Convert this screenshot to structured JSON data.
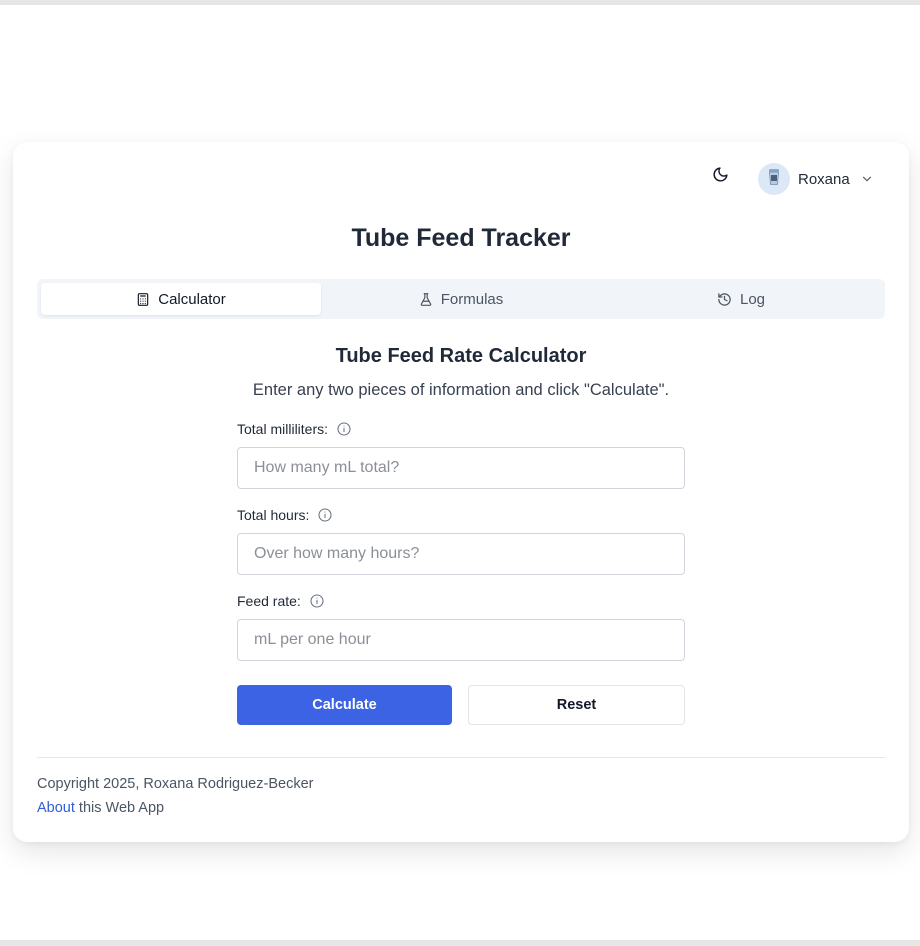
{
  "app": {
    "title": "Tube Feed Tracker"
  },
  "header": {
    "theme_icon": "moon-icon",
    "user": {
      "name": "Roxana",
      "avatar_icon": "cup-icon"
    }
  },
  "tabs": [
    {
      "label": "Calculator",
      "icon": "calculator-icon",
      "active": true
    },
    {
      "label": "Formulas",
      "icon": "flask-icon",
      "active": false
    },
    {
      "label": "Log",
      "icon": "history-icon",
      "active": false
    }
  ],
  "calculator": {
    "title": "Tube Feed Rate Calculator",
    "subtitle": "Enter any two pieces of information and click \"Calculate\".",
    "fields": [
      {
        "label": "Total milliliters:",
        "placeholder": "How many mL total?",
        "value": ""
      },
      {
        "label": "Total hours:",
        "placeholder": "Over how many hours?",
        "value": ""
      },
      {
        "label": "Feed rate:",
        "placeholder": "mL per one hour",
        "value": ""
      }
    ],
    "calculate_label": "Calculate",
    "reset_label": "Reset"
  },
  "footer": {
    "copyright": "Copyright 2025, Roxana Rodriguez-Becker",
    "about_link": "About",
    "about_rest": " this Web App"
  },
  "colors": {
    "accent": "#3b63e4",
    "link": "#2f5ed8",
    "tab_bar_bg": "#f1f4f9",
    "avatar_bg": "#dde8f7"
  }
}
